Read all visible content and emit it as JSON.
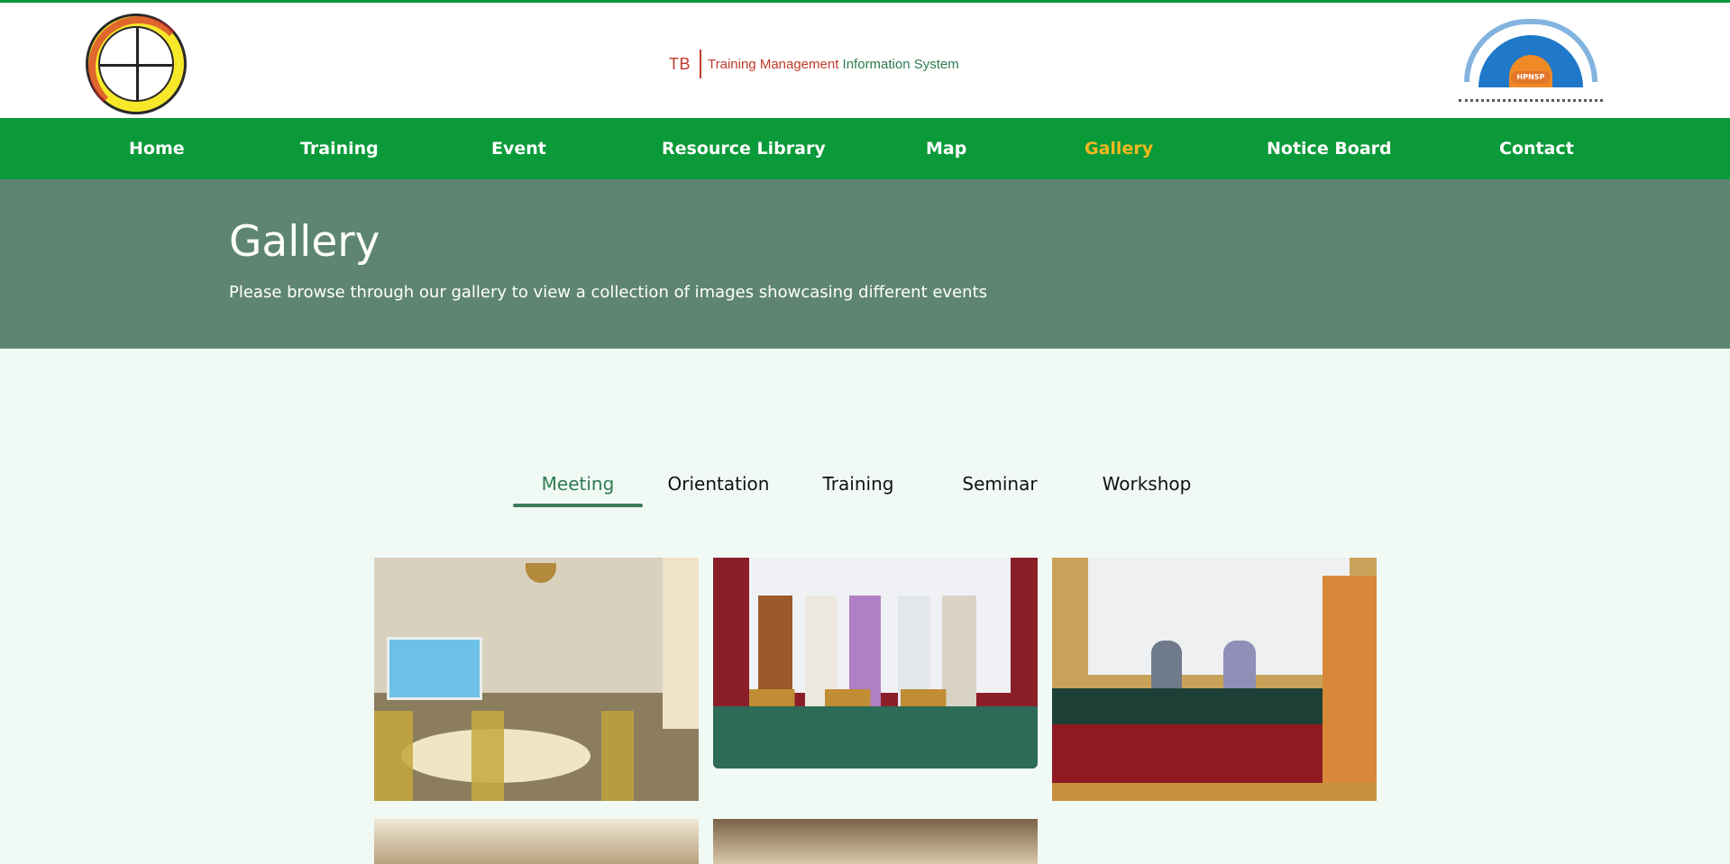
{
  "header": {
    "brand_short": "TB",
    "brand_title_red": "Training Management ",
    "brand_title_green": "Information System",
    "left_logo": "national-tb-control-programme-logo",
    "right_logo": "hpnsp-ministry-logo"
  },
  "nav": {
    "items": [
      {
        "label": "Home",
        "active": false
      },
      {
        "label": "Training",
        "active": false
      },
      {
        "label": "Event",
        "active": false
      },
      {
        "label": "Resource Library",
        "active": false
      },
      {
        "label": "Map",
        "active": false
      },
      {
        "label": "Gallery",
        "active": true
      },
      {
        "label": "Notice Board",
        "active": false
      },
      {
        "label": "Contact",
        "active": false
      }
    ]
  },
  "hero": {
    "title": "Gallery",
    "subtitle": "Please browse through our gallery to view a collection of images showcasing different events"
  },
  "tabs": {
    "items": [
      {
        "label": "Meeting",
        "active": true
      },
      {
        "label": "Orientation",
        "active": false
      },
      {
        "label": "Training",
        "active": false
      },
      {
        "label": "Seminar",
        "active": false
      },
      {
        "label": "Workshop",
        "active": false
      }
    ]
  },
  "colors": {
    "nav_bg": "#0b9a39",
    "nav_active": "#f4b81f",
    "hero_bg": "#5e8571",
    "page_bg": "#f1f9f5",
    "tab_active": "#2f7a4f"
  }
}
